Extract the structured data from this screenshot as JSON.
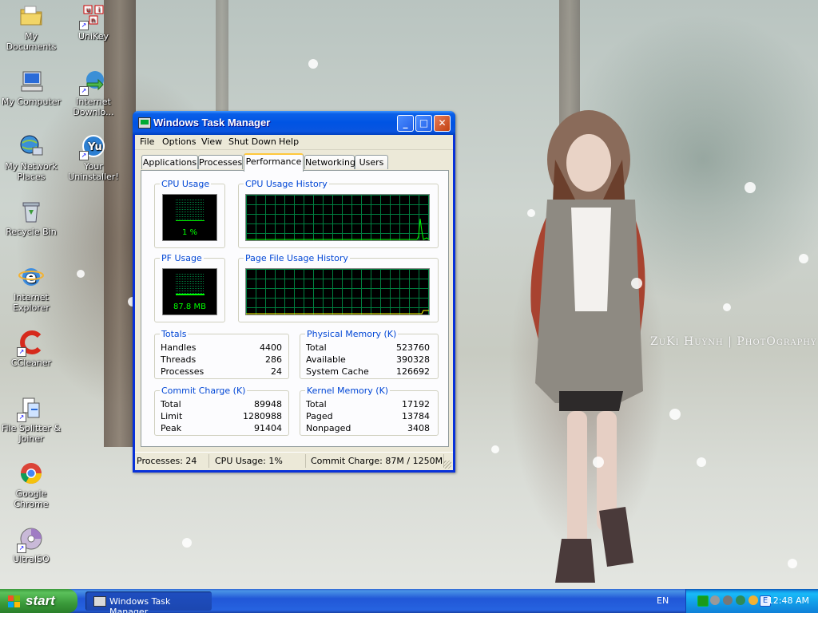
{
  "desktop": {
    "watermark": "ZuKi Huỳnh | PhotOgraphy",
    "icons": [
      {
        "label": "My Documents",
        "icon": "folder-icon"
      },
      {
        "label": "UniKey",
        "icon": "unikey-icon"
      },
      {
        "label": "My Computer",
        "icon": "computer-icon"
      },
      {
        "label": "Internet Downlo...",
        "icon": "idm-icon"
      },
      {
        "label": "My Network Places",
        "icon": "network-icon"
      },
      {
        "label": "Your Uninstaller!",
        "icon": "uninstaller-icon"
      },
      {
        "label": "Recycle Bin",
        "icon": "recycle-bin-icon"
      },
      {
        "label": "Internet Explorer",
        "icon": "ie-icon"
      },
      {
        "label": "CCleaner",
        "icon": "ccleaner-icon"
      },
      {
        "label": "File Splitter & Joiner",
        "icon": "file-splitter-icon"
      },
      {
        "label": "Google Chrome",
        "icon": "chrome-icon"
      },
      {
        "label": "UltraISO",
        "icon": "ultraiso-icon"
      }
    ]
  },
  "window": {
    "title": "Windows Task Manager",
    "buttons": {
      "minimize": "_",
      "maximize": "□",
      "close": "✕"
    },
    "menu": [
      "File",
      "Options",
      "View",
      "Shut Down",
      "Help"
    ],
    "tabs": [
      "Applications",
      "Processes",
      "Performance",
      "Networking",
      "Users"
    ],
    "active_tab": "Performance",
    "performance": {
      "cpu_usage": {
        "label": "CPU Usage",
        "value": "1 %",
        "level": 0.01
      },
      "cpu_history": {
        "label": "CPU Usage History"
      },
      "pf_usage": {
        "label": "PF Usage",
        "value": "87.8 MB",
        "level": 0.07
      },
      "pf_history": {
        "label": "Page File Usage History"
      },
      "totals": {
        "label": "Totals",
        "rows": [
          {
            "name": "Handles",
            "value": "4400"
          },
          {
            "name": "Threads",
            "value": "286"
          },
          {
            "name": "Processes",
            "value": "24"
          }
        ]
      },
      "physical_memory": {
        "label": "Physical Memory (K)",
        "rows": [
          {
            "name": "Total",
            "value": "523760"
          },
          {
            "name": "Available",
            "value": "390328"
          },
          {
            "name": "System Cache",
            "value": "126692"
          }
        ]
      },
      "commit_charge": {
        "label": "Commit Charge (K)",
        "rows": [
          {
            "name": "Total",
            "value": "89948"
          },
          {
            "name": "Limit",
            "value": "1280988"
          },
          {
            "name": "Peak",
            "value": "91404"
          }
        ]
      },
      "kernel_memory": {
        "label": "Kernel Memory (K)",
        "rows": [
          {
            "name": "Total",
            "value": "17192"
          },
          {
            "name": "Paged",
            "value": "13784"
          },
          {
            "name": "Nonpaged",
            "value": "3408"
          }
        ]
      }
    },
    "status": {
      "processes": "Processes: 24",
      "cpu": "CPU Usage: 1%",
      "commit": "Commit Charge: 87M / 1250M"
    }
  },
  "taskbar": {
    "start_label": "start",
    "task_button": "Windows Task Manager",
    "language": "EN",
    "clock": "12:48 AM"
  },
  "colors": {
    "xp_blue": "#0054e3",
    "start_green": "#3a9a3a",
    "meter_green": "#00ff00",
    "group_label": "#0046d5"
  }
}
